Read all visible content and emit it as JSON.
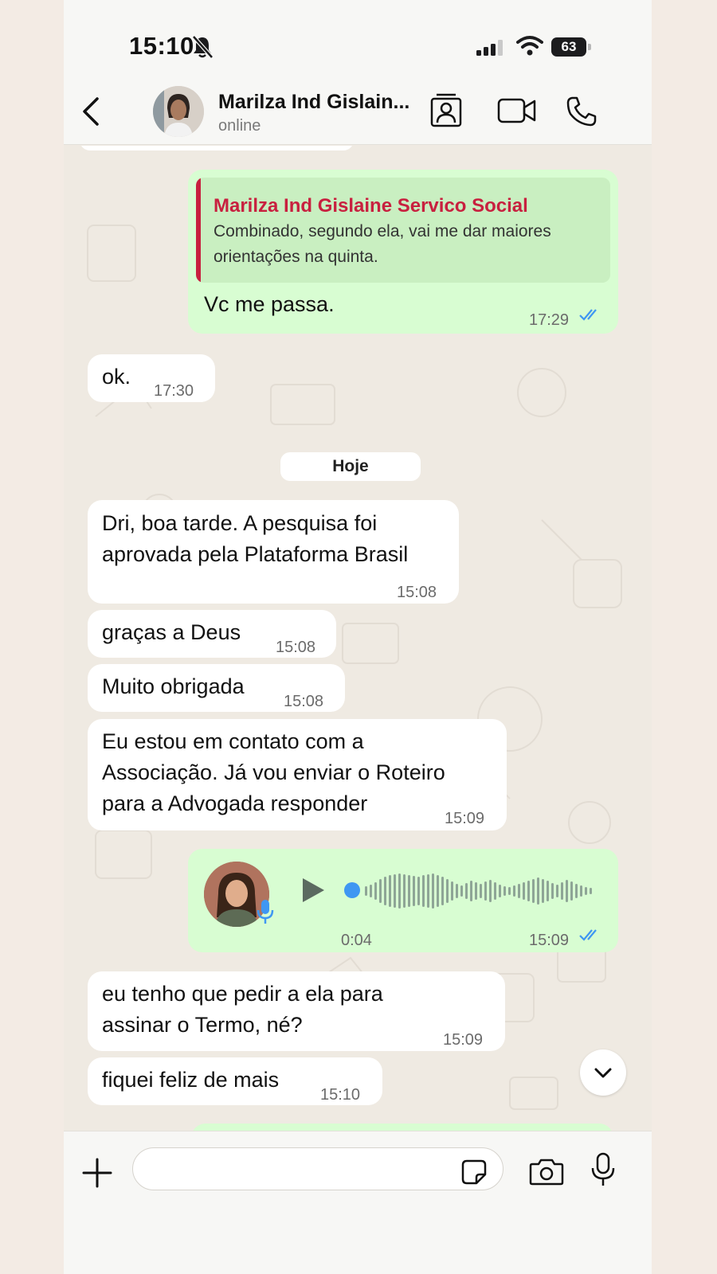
{
  "status_bar": {
    "time": "15:10",
    "battery": "63"
  },
  "header": {
    "contact_name": "Marilza Ind Gislain...",
    "contact_status": "online"
  },
  "messages": {
    "m1": {
      "quote_author": "Marilza Ind Gislaine Servico Social",
      "quote_text": "Combinado, segundo ela, vai me dar maiores orientações na quinta.",
      "text": "Vc me passa.",
      "time": "17:29"
    },
    "m2": {
      "text": "ok.",
      "time": "17:30"
    },
    "date_chip": "Hoje",
    "m3": {
      "line1": "Dri, boa tarde. A pesquisa foi",
      "line2": "aprovada pela Plataforma Brasil",
      "time": "15:08"
    },
    "m4": {
      "text": "graças a Deus",
      "time": "15:08"
    },
    "m5": {
      "text": "Muito obrigada",
      "time": "15:08"
    },
    "m6": {
      "line1": "Eu estou em contato com a",
      "line2": "Associação. Já vou enviar o Roteiro",
      "line3": "para a Advogada responder",
      "time": "15:09"
    },
    "voice": {
      "duration": "0:04",
      "time": "15:09",
      "progress": 0.0
    },
    "m7": {
      "line1": "eu tenho que pedir a ela para",
      "line2": "assinar o Termo, né?",
      "time": "15:09"
    },
    "m8": {
      "text": "fiquei feliz de mais",
      "time": "15:10"
    }
  },
  "composer": {
    "placeholder": ""
  },
  "colors": {
    "outgoing": "#d8fdd2",
    "incoming": "#ffffff",
    "quote_accent": "#c8203f",
    "read_ticks": "#3f97f2"
  }
}
